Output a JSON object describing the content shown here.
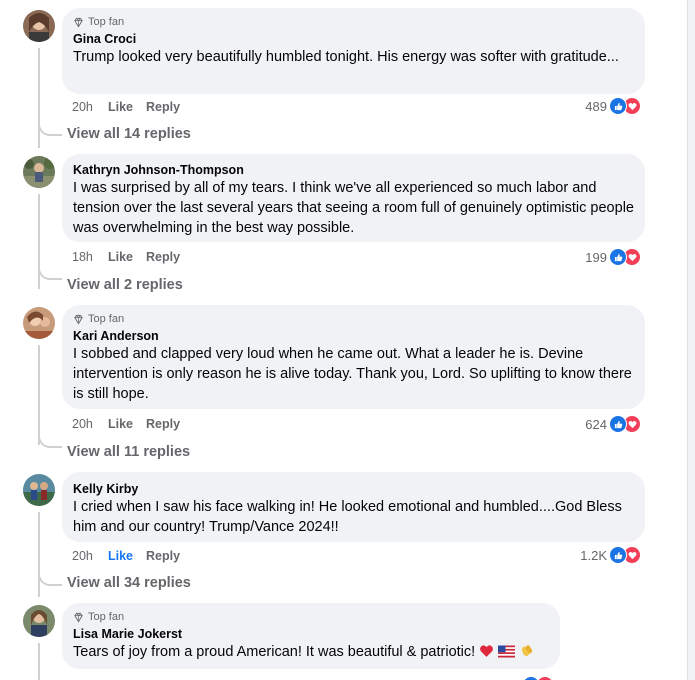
{
  "comments": [
    {
      "badge": "Top fan",
      "author": "Gina Croci",
      "text": "Trump looked very beautifully humbled tonight. His energy was softer with gratitude...",
      "time": "20h",
      "like": "Like",
      "reply": "Reply",
      "reaction_count": "489",
      "view_replies": "View all 14 replies"
    },
    {
      "author": "Kathryn Johnson-Thompson",
      "text": "I was surprised by all of my tears. I think we've all experienced so much labor and tension over the last several years that seeing a room full of genuinely optimistic people was overwhelming in the best way possible.",
      "time": "18h",
      "like": "Like",
      "reply": "Reply",
      "reaction_count": "199",
      "view_replies": "View all 2 replies"
    },
    {
      "badge": "Top fan",
      "author": "Kari Anderson",
      "text": "I sobbed and clapped very loud when he came out. What a leader he is. Devine intervention is only reason he is alive today. Thank you, Lord. So uplifting to know there is still hope.",
      "time": "20h",
      "like": "Like",
      "reply": "Reply",
      "reaction_count": "624",
      "view_replies": "View all 11 replies"
    },
    {
      "author": "Kelly Kirby",
      "text": "I cried when I saw his face walking in! He looked emotional and humbled....God Bless him and our country! Trump/Vance 2024!!",
      "time": "20h",
      "like": "Like",
      "reply": "Reply",
      "reaction_count": "1.2K",
      "view_replies": "View all 34 replies"
    },
    {
      "badge": "Top fan",
      "author": "Lisa Marie Jokerst",
      "text": "Tears of joy from a proud American! It was beautiful & patriotic!",
      "time": "",
      "like": "",
      "reply": "",
      "reaction_count": "",
      "view_replies": ""
    }
  ],
  "colors": {
    "like_active": "#1877f2",
    "like_reaction": "#1b74e4",
    "love_reaction": "#f33e58",
    "bubble": "#f0f2f5",
    "meta_text": "#65676b"
  }
}
